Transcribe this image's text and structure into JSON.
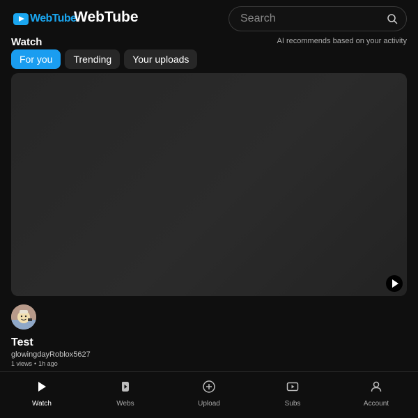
{
  "header": {
    "logo_text": "WebTube",
    "app_title": "WebTube",
    "search_placeholder": "Search"
  },
  "section": {
    "title": "Watch",
    "note": "AI recommends based on your activity"
  },
  "chips": [
    {
      "label": "For you",
      "active": true
    },
    {
      "label": "Trending",
      "active": false
    },
    {
      "label": "Your uploads",
      "active": false
    }
  ],
  "video": {
    "title": "Test",
    "channel": "glowingdayRoblox5627",
    "views": "1 views",
    "separator": "•",
    "time": "1h ago"
  },
  "nav": [
    {
      "label": "Watch",
      "icon": "play-icon",
      "active": true
    },
    {
      "label": "Webs",
      "icon": "shorts-icon",
      "active": false
    },
    {
      "label": "Upload",
      "icon": "plus-circle-icon",
      "active": false
    },
    {
      "label": "Subs",
      "icon": "subscriptions-icon",
      "active": false
    },
    {
      "label": "Account",
      "icon": "user-icon",
      "active": false
    }
  ],
  "colors": {
    "background": "#0f0f0f",
    "accent": "#1a9df0",
    "chip": "#272727",
    "player": "#282828"
  }
}
